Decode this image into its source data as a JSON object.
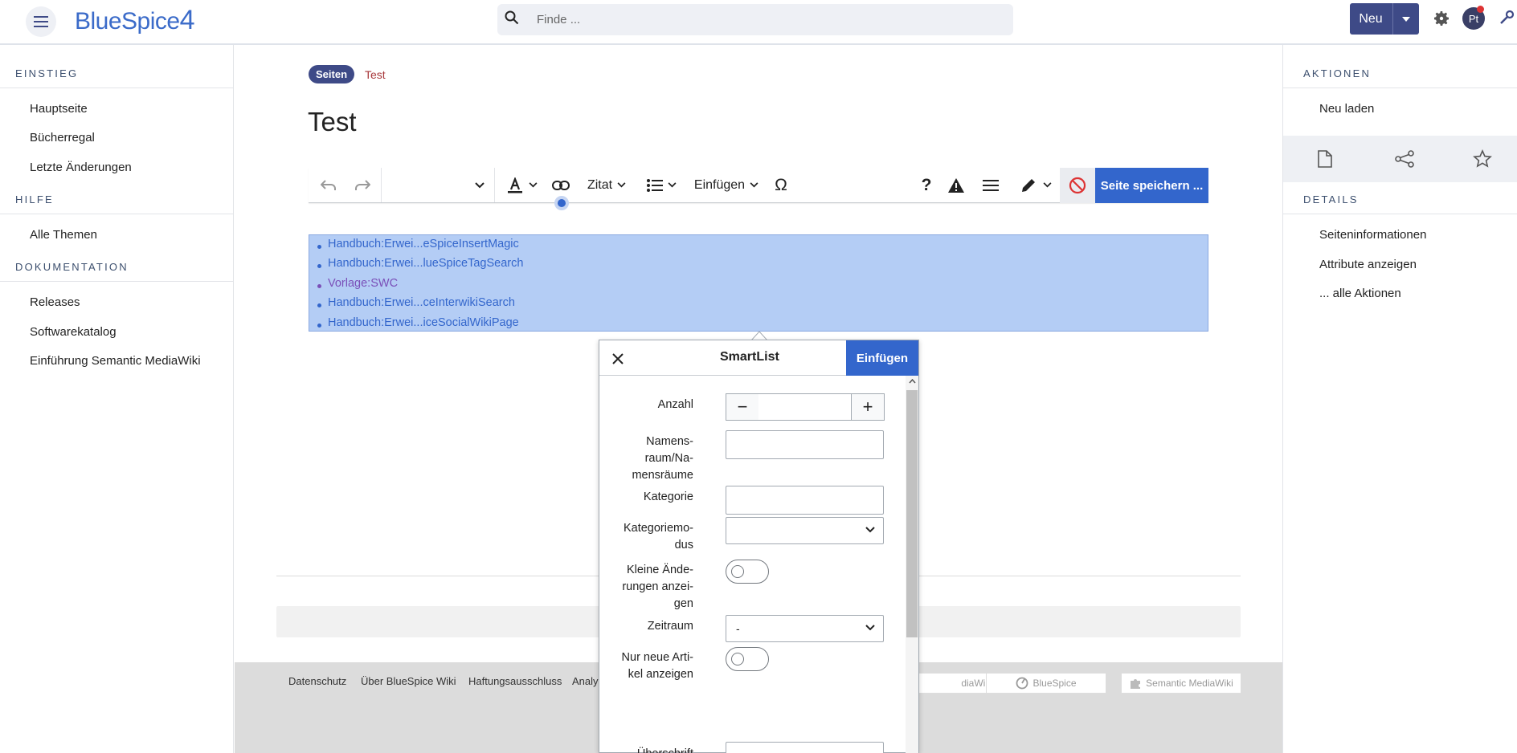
{
  "header": {
    "logo_text": "BlueSpice",
    "logo_version": "4",
    "search_placeholder": "Finde ...",
    "new_label": "Neu",
    "avatar_initials": "Pt"
  },
  "left_sidebar": {
    "sections": [
      {
        "title": "EINSTIEG",
        "items": [
          "Hauptseite",
          "Bücherregal",
          "Letzte Änderungen"
        ]
      },
      {
        "title": "HILFE",
        "items": [
          "Alle Themen"
        ]
      },
      {
        "title": "DOKUMENTATION",
        "items": [
          "Releases",
          "Softwarekatalog",
          "Einführung Semantic MediaWiki"
        ]
      }
    ]
  },
  "right_sidebar": {
    "actions_title": "AKTIONEN",
    "reload": "Neu laden",
    "details_title": "DETAILS",
    "details": [
      "Seiteninformationen",
      "Attribute anzeigen",
      "... alle Aktionen"
    ]
  },
  "breadcrumb": {
    "badge": "Seiten",
    "link": "Test"
  },
  "page": {
    "title": "Test"
  },
  "toolbar": {
    "quote": "Zitat",
    "insert": "Einfügen",
    "omega": "Ω",
    "help": "?",
    "save": "Seite speichern ..."
  },
  "list_items": [
    "Handbuch:Erwei...eSpiceInsertMagic",
    "Handbuch:Erwei...lueSpiceTagSearch",
    "Vorlage:SWC",
    "Handbuch:Erwei...ceInterwikiSearch",
    "Handbuch:Erwei...iceSocialWikiPage"
  ],
  "dialog": {
    "title": "SmartList",
    "insert": "Einfügen",
    "fields": {
      "count": "Anzahl",
      "namespace": "Namens-\nraum/Na-\nmensräume",
      "category": "Kategorie",
      "category_mode": "Kategoriemo-\ndus",
      "minor_changes": "Kleine Ände-\nrungen anzei-\ngen",
      "period": "Zeitraum",
      "period_value": "-",
      "new_only": "Nur neue Arti-\nkel anzeigen",
      "heading": "Überschrift"
    },
    "minus": "−",
    "plus": "+"
  },
  "footer": {
    "links": [
      "Datenschutz",
      "Über BlueSpice Wiki",
      "Haftungsausschluss",
      "Analy"
    ],
    "badges": [
      "diaWiki",
      "BlueSpice",
      "Semantic MediaWiki"
    ]
  },
  "colors": {
    "accent": "#3366cc",
    "brand": "#3e4a87",
    "selection": "#b4cdf5"
  }
}
